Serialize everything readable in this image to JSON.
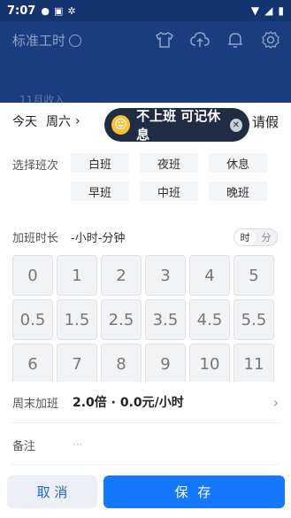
{
  "status_bar": {
    "time": "7:07"
  },
  "header": {
    "title": "标准工时",
    "month_income": "11月收入"
  },
  "date_row": {
    "today": "今天",
    "weekday": "周六",
    "leave": "请假"
  },
  "tooltip": {
    "text": "不上班 可记休息"
  },
  "shift": {
    "label": "选择班次",
    "options": [
      "白班",
      "夜班",
      "休息",
      "早班",
      "中班",
      "晚班"
    ]
  },
  "overtime": {
    "label": "加班时长",
    "value": "-小时-分钟",
    "unit_hour": "时",
    "unit_minute": "分"
  },
  "keypad": {
    "keys": [
      "0",
      "1",
      "2",
      "3",
      "4",
      "5",
      "0.5",
      "1.5",
      "2.5",
      "3.5",
      "4.5",
      "5.5",
      "6",
      "7",
      "8",
      "9",
      "10",
      "11"
    ]
  },
  "weekend": {
    "label": "周末加班",
    "value": "2.0倍 · 0.0元/小时"
  },
  "note": {
    "label": "备注",
    "placeholder": "···"
  },
  "footer": {
    "cancel": "取 消",
    "save": "保 存"
  },
  "colors": {
    "primary": "#1677ff",
    "header_bg": "#1b3d80",
    "tooltip_bg": "#1f2c43"
  }
}
